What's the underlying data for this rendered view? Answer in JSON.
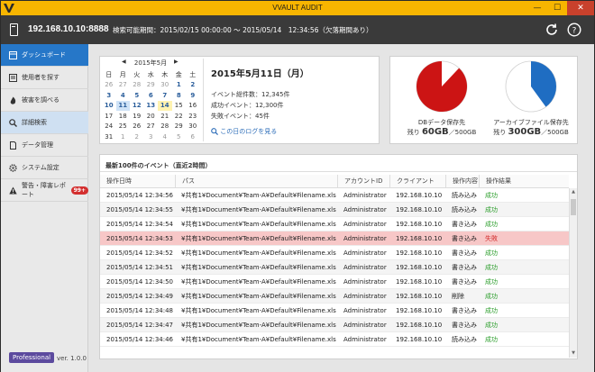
{
  "window": {
    "title": "VVAULT AUDIT",
    "minimize": "—",
    "maximize": "☐",
    "close": "✕"
  },
  "header": {
    "server": "192.168.10.10:8888",
    "range": "検索可能期間：2015/02/15 00:00:00 ～ 2015/05/14　12:34:56（欠落期間あり）"
  },
  "sidebar": {
    "items": [
      {
        "label": "ダッシュボード",
        "icon": "dashboard-icon"
      },
      {
        "label": "使用者を探す",
        "icon": "user-search-icon"
      },
      {
        "label": "被害を調べる",
        "icon": "flame-icon"
      },
      {
        "label": "詳細検索",
        "icon": "search-icon"
      },
      {
        "label": "データ管理",
        "icon": "document-icon"
      },
      {
        "label": "システム設定",
        "icon": "gear-icon"
      },
      {
        "label": "警告・障害レポート",
        "icon": "warning-icon",
        "badge": "99+"
      }
    ],
    "edition": "Professional",
    "version": "ver. 1.0.0"
  },
  "calendar": {
    "month": "2015年5月",
    "weekdays": [
      "日",
      "月",
      "火",
      "水",
      "木",
      "金",
      "土"
    ],
    "weeks": [
      [
        {
          "d": "26",
          "t": "o"
        },
        {
          "d": "27",
          "t": "o"
        },
        {
          "d": "28",
          "t": "o"
        },
        {
          "d": "29",
          "t": "o"
        },
        {
          "d": "30",
          "t": "o"
        },
        {
          "d": "1",
          "t": "n"
        },
        {
          "d": "2",
          "t": "n"
        }
      ],
      [
        {
          "d": "3",
          "t": "n"
        },
        {
          "d": "4",
          "t": "n"
        },
        {
          "d": "5",
          "t": "n"
        },
        {
          "d": "6",
          "t": "n"
        },
        {
          "d": "7",
          "t": "n"
        },
        {
          "d": "8",
          "t": "n"
        },
        {
          "d": "9",
          "t": "n"
        }
      ],
      [
        {
          "d": "10",
          "t": "n"
        },
        {
          "d": "11",
          "t": "sel"
        },
        {
          "d": "12",
          "t": "n"
        },
        {
          "d": "13",
          "t": "n"
        },
        {
          "d": "14",
          "t": "today"
        },
        {
          "d": "15",
          "t": "p"
        },
        {
          "d": "16",
          "t": "p"
        }
      ],
      [
        {
          "d": "17",
          "t": "p"
        },
        {
          "d": "18",
          "t": "p"
        },
        {
          "d": "19",
          "t": "p"
        },
        {
          "d": "20",
          "t": "p"
        },
        {
          "d": "21",
          "t": "p"
        },
        {
          "d": "22",
          "t": "p"
        },
        {
          "d": "23",
          "t": "p"
        }
      ],
      [
        {
          "d": "24",
          "t": "p"
        },
        {
          "d": "25",
          "t": "p"
        },
        {
          "d": "26",
          "t": "p"
        },
        {
          "d": "27",
          "t": "p"
        },
        {
          "d": "28",
          "t": "p"
        },
        {
          "d": "29",
          "t": "p"
        },
        {
          "d": "30",
          "t": "p"
        }
      ],
      [
        {
          "d": "31",
          "t": "p"
        },
        {
          "d": "1",
          "t": "o"
        },
        {
          "d": "2",
          "t": "o"
        },
        {
          "d": "3",
          "t": "o"
        },
        {
          "d": "4",
          "t": "o"
        },
        {
          "d": "5",
          "t": "o"
        },
        {
          "d": "6",
          "t": "o"
        }
      ]
    ]
  },
  "summary": {
    "date": "2015年5月11日（月）",
    "total": "イベント総件数：12,345件",
    "success": "成功イベント：12,300件",
    "failure": "失敗イベント：45件",
    "link": "この日のログを見る"
  },
  "storage": {
    "db": {
      "label": "DBデータ保存先",
      "remain_prefix": "残り",
      "remain": "60GB",
      "total": "／500GB",
      "used_fraction": 0.88,
      "color": "#cc1414"
    },
    "archive": {
      "label": "アーカイブファイル保存先",
      "remain_prefix": "残り",
      "remain": "300GB",
      "total": "／500GB",
      "used_fraction": 0.4,
      "color": "#1f6dc2"
    }
  },
  "events": {
    "title": "最新100件のイベント（直近2時間）",
    "columns": [
      "操作日時",
      "パス",
      "アカウントID",
      "クライアント",
      "操作内容",
      "操作結果"
    ],
    "rows": [
      {
        "time": "2015/05/14 12:34:56",
        "path": "¥共有1¥Document¥Team-A¥Default¥Filename.xls",
        "account": "Administrator",
        "client": "192.168.10.10",
        "op": "読み込み",
        "result": "成功",
        "status": "ok"
      },
      {
        "time": "2015/05/14 12:34:55",
        "path": "¥共有1¥Document¥Team-A¥Default¥Filename.xls",
        "account": "Administrator",
        "client": "192.168.10.10",
        "op": "読み込み",
        "result": "成功",
        "status": "ok"
      },
      {
        "time": "2015/05/14 12:34:54",
        "path": "¥共有1¥Document¥Team-A¥Default¥Filename.xls",
        "account": "Administrator",
        "client": "192.168.10.10",
        "op": "書き込み",
        "result": "成功",
        "status": "ok"
      },
      {
        "time": "2015/05/14 12:34:53",
        "path": "¥共有1¥Document¥Team-A¥Default¥Filename.xls",
        "account": "Administrator",
        "client": "192.168.10.10",
        "op": "書き込み",
        "result": "失敗",
        "status": "ng"
      },
      {
        "time": "2015/05/14 12:34:52",
        "path": "¥共有1¥Document¥Team-A¥Default¥Filename.xls",
        "account": "Administrator",
        "client": "192.168.10.10",
        "op": "書き込み",
        "result": "成功",
        "status": "ok"
      },
      {
        "time": "2015/05/14 12:34:51",
        "path": "¥共有1¥Document¥Team-A¥Default¥Filename.xls",
        "account": "Administrator",
        "client": "192.168.10.10",
        "op": "書き込み",
        "result": "成功",
        "status": "ok"
      },
      {
        "time": "2015/05/14 12:34:50",
        "path": "¥共有1¥Document¥Team-A¥Default¥Filename.xls",
        "account": "Administrator",
        "client": "192.168.10.10",
        "op": "書き込み",
        "result": "成功",
        "status": "ok"
      },
      {
        "time": "2015/05/14 12:34:49",
        "path": "¥共有1¥Document¥Team-A¥Default¥Filename.xls",
        "account": "Administrator",
        "client": "192.168.10.10",
        "op": "削除",
        "result": "成功",
        "status": "ok"
      },
      {
        "time": "2015/05/14 12:34:48",
        "path": "¥共有1¥Document¥Team-A¥Default¥Filename.xls",
        "account": "Administrator",
        "client": "192.168.10.10",
        "op": "書き込み",
        "result": "成功",
        "status": "ok"
      },
      {
        "time": "2015/05/14 12:34:47",
        "path": "¥共有1¥Document¥Team-A¥Default¥Filename.xls",
        "account": "Administrator",
        "client": "192.168.10.10",
        "op": "書き込み",
        "result": "成功",
        "status": "ok"
      },
      {
        "time": "2015/05/14 12:34:46",
        "path": "¥共有1¥Document¥Team-A¥Default¥Filename.xls",
        "account": "Administrator",
        "client": "192.168.10.10",
        "op": "読み込み",
        "result": "成功",
        "status": "ok"
      }
    ]
  }
}
